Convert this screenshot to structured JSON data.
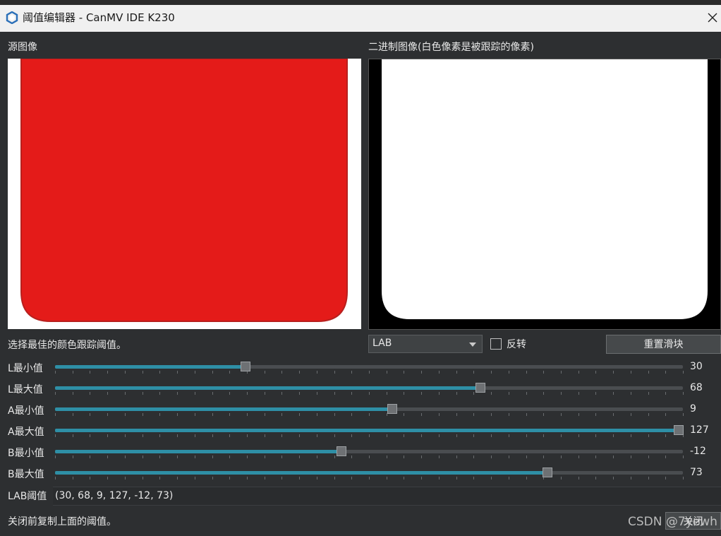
{
  "window": {
    "title": "阈值编辑器 - CanMV IDE K230",
    "close_glyph": "✕"
  },
  "source_panel": {
    "label": "源图像",
    "fill_color": "#e41b19"
  },
  "binary_panel": {
    "label": "二进制图像(白色像素是被跟踪的像素)"
  },
  "controls": {
    "hint": "选择最佳的颜色跟踪阈值。",
    "color_space": "LAB",
    "invert_label": "反转",
    "invert_checked": false,
    "reset_label": "重置滑块"
  },
  "sliders": [
    {
      "label": "L最小值",
      "value": "30"
    },
    {
      "label": "L最大值",
      "value": "68"
    },
    {
      "label": "A最小值",
      "value": "9"
    },
    {
      "label": "A最大值",
      "value": "127"
    },
    {
      "label": "B最小值",
      "value": "-12"
    },
    {
      "label": "B最大值",
      "value": "73"
    }
  ],
  "threshold": {
    "label": "LAB阈值",
    "value": "(30, 68, 9, 127, -12, 73)"
  },
  "footer": {
    "note": "关闭前复制上面的阈值。",
    "close_label": "关闭",
    "watermark": "CSDN @7yewh"
  },
  "colors": {
    "accent": "#2e8fa6",
    "background": "#2d2f31",
    "red": "#e41b19"
  }
}
